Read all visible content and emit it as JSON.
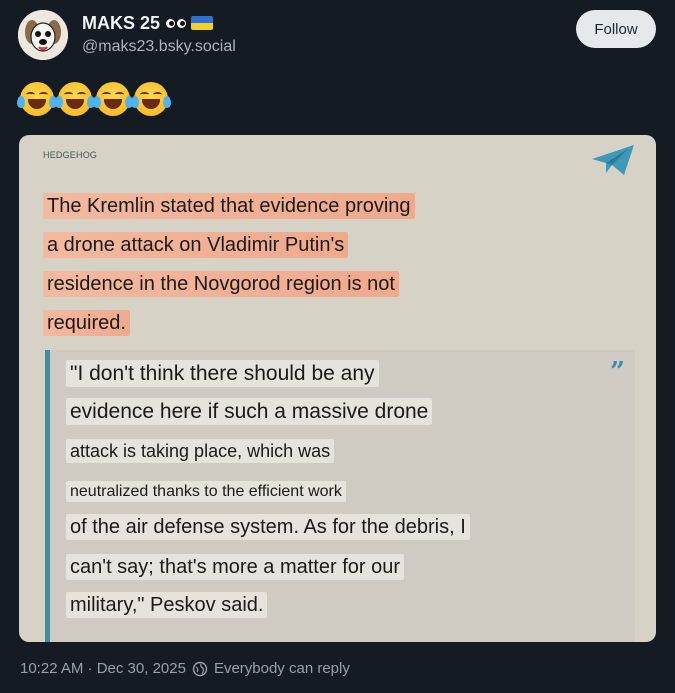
{
  "post": {
    "author": {
      "display_name": "MAKS 25",
      "handle": "@maks23.bsky.social",
      "name_emoji": [
        "eyes-icon",
        "ukraine-flag-icon"
      ]
    },
    "follow_label": "Follow",
    "text_emoji": [
      "face-with-tears-of-joy",
      "face-with-tears-of-joy",
      "face-with-tears-of-joy",
      "face-with-tears-of-joy"
    ],
    "image": {
      "source_tag": "HEDGEHOG",
      "headline_lines": [
        "The Kremlin stated that evidence proving",
        "a drone attack on Vladimir Putin's",
        "residence in the Novgorod region is not",
        "required."
      ],
      "quote_lines": [
        "\"I don't think there should be any",
        "evidence here if such a massive drone",
        "attack is taking place, which was",
        "neutralized thanks to the efficient work",
        "of the air defense system. As for the debris, I",
        "can't say; that's more a matter for our",
        "military,\" Peskov said."
      ]
    },
    "footer": {
      "timestamp": "10:22 AM · Dec 30, 2025",
      "reply_setting": "Everybody can reply"
    }
  },
  "colors": {
    "background": "#151b23",
    "card": "#d7d2c6",
    "highlight": "#f3b9a0",
    "quote_accent": "#3a8fa8",
    "follow_button": "#e6e9ec"
  }
}
